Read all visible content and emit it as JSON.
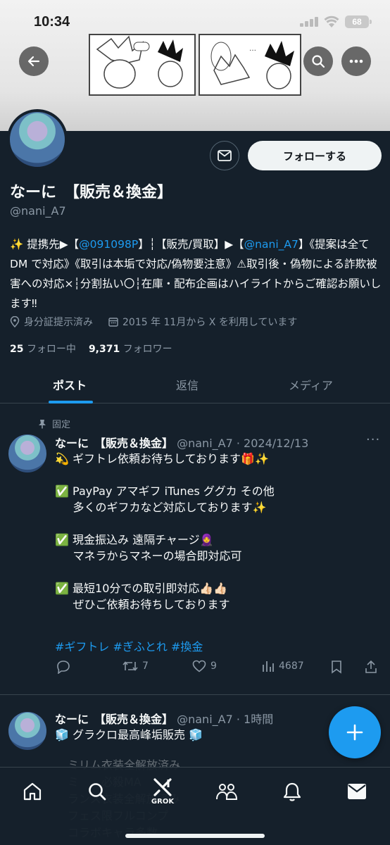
{
  "status": {
    "time": "10:34",
    "battery": "68"
  },
  "profile": {
    "name": "なーに　【販売＆換金】",
    "handle": "@nani_A7",
    "follow_label": "フォローする",
    "bio_pre": "✨ 提携先▶【",
    "bio_link1": "@091098P",
    "bio_mid": "】┆【販売/買取】▶【",
    "bio_link2": "@nani_A7",
    "bio_post": "】《提案は全てDM で対応》《取引は本垢で対応/偽物要注意》⚠︎取引後・偽物による詐欺被害への対応×┆分割払い〇┆在庫・配布企画はハイライトからご確認お願いします‼︎",
    "verification": "身分証提示済み",
    "joined": "2015 年 11月から X を利用しています",
    "following_count": "25",
    "following_label": "フォロー中",
    "followers_count": "9,371",
    "followers_label": "フォロワー"
  },
  "tabs": [
    "ポスト",
    "返信",
    "メディア"
  ],
  "posts": [
    {
      "pinned_label": "固定",
      "name": "なーに　【販売＆換金】",
      "meta": "@nani_A7 · 2024/12/13",
      "body": "💫 ギフトレ依頼お待ちしております🎁✨\n\n✅ PayPay アマギフ iTunes ググカ その他\n     多くのギフカなど対応しております✨\n\n✅ 現金振込み 遠隔チャージ🧕\n     マネラからマネーの場合即対応可\n\n✅ 最短10分での取引即対応👍🏻👍🏻\n     ぜひご依頼お待ちしております",
      "hashtags": "#ギフトレ #ぎふとれ #換金",
      "retweets": "7",
      "likes": "9",
      "views": "4687"
    },
    {
      "name": "なーに　【販売＆換金】",
      "meta": "@nani_A7 · 1時間",
      "body": "🧊 グラクロ最高峰垢販売 🧊",
      "faded_lines": "ミリム衣装全解放済み\nミ　　必殺MA\nランス衣装全解放済み\nフェス限フルコンプ\nコラボキャラ多数"
    }
  ],
  "bottom_nav": {
    "grok_label": "GROK"
  },
  "colors": {
    "accent": "#1d9bf0",
    "background": "#15202b",
    "muted": "#8b98a5"
  }
}
